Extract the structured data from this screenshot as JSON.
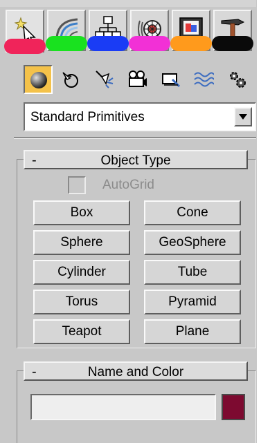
{
  "main_tabs": [
    {
      "name": "create",
      "icon": "create-cursor-icon",
      "color": "#f0245a"
    },
    {
      "name": "modify",
      "icon": "modify-rainbow-icon",
      "color": "#19e21f"
    },
    {
      "name": "hierarchy",
      "icon": "hierarchy-icon",
      "color": "#1a3cf5"
    },
    {
      "name": "motion",
      "icon": "motion-wheel-icon",
      "color": "#f230d6"
    },
    {
      "name": "display",
      "icon": "display-monitor-icon",
      "color": "#ff9a1c"
    },
    {
      "name": "utilities",
      "icon": "utilities-hammer-icon",
      "color": "#0a0a0a"
    }
  ],
  "sub_tabs": [
    {
      "name": "geometry",
      "icon": "sphere-icon",
      "active": true
    },
    {
      "name": "shapes",
      "icon": "shapes-icon"
    },
    {
      "name": "lights",
      "icon": "lights-icon"
    },
    {
      "name": "cameras",
      "icon": "camera-icon"
    },
    {
      "name": "helpers",
      "icon": "helpers-icon"
    },
    {
      "name": "space_warps",
      "icon": "space-warps-icon"
    },
    {
      "name": "systems",
      "icon": "systems-gear-icon"
    }
  ],
  "category_dropdown": {
    "value": "Standard Primitives"
  },
  "object_type": {
    "toggle": "-",
    "title": "Object Type",
    "autogrid_label": "AutoGrid",
    "buttons": [
      "Box",
      "Cone",
      "Sphere",
      "GeoSphere",
      "Cylinder",
      "Tube",
      "Torus",
      "Pyramid",
      "Teapot",
      "Plane"
    ]
  },
  "name_and_color": {
    "toggle": "-",
    "title": "Name and Color",
    "name_value": "",
    "color": "#7d0a30"
  }
}
